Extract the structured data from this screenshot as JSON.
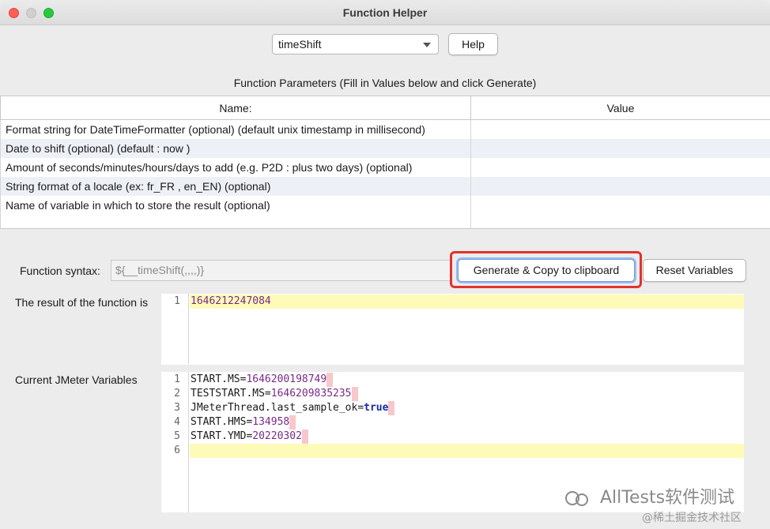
{
  "window": {
    "title": "Function Helper"
  },
  "toolbar": {
    "function_select_value": "timeShift",
    "help_label": "Help"
  },
  "params": {
    "caption": "Function Parameters (Fill in Values below and click Generate)",
    "col_name": "Name:",
    "col_value": "Value",
    "rows": [
      {
        "name": "Format string for DateTimeFormatter (optional) (default unix timestamp in millisecond)",
        "value": ""
      },
      {
        "name": "Date to shift (optional) (default : now )",
        "value": ""
      },
      {
        "name": "Amount of seconds/minutes/hours/days to add (e.g. P2D : plus two days) (optional)",
        "value": ""
      },
      {
        "name": "String format of a locale (ex: fr_FR , en_EN) (optional)",
        "value": ""
      },
      {
        "name": "Name of variable in which to store the result (optional)",
        "value": ""
      }
    ]
  },
  "syntax": {
    "label": "Function syntax:",
    "value": "${__timeShift(,,,,)}"
  },
  "buttons": {
    "generate_label": "Generate & Copy to clipboard",
    "reset_label": "Reset Variables"
  },
  "result": {
    "label": "The result of the function is",
    "lines": [
      {
        "n": "1",
        "text": "1646212247084"
      }
    ]
  },
  "vars": {
    "label": "Current JMeter Variables",
    "lines": [
      {
        "n": "1",
        "key": "START.MS=",
        "val": "1646200198749"
      },
      {
        "n": "2",
        "key": "TESTSTART.MS=",
        "val": "1646209835235"
      },
      {
        "n": "3",
        "key": "JMeterThread.last_sample_ok=",
        "val": "true"
      },
      {
        "n": "4",
        "key": "START.HMS=",
        "val": "134958"
      },
      {
        "n": "5",
        "key": "START.YMD=",
        "val": "20220302"
      },
      {
        "n": "6",
        "key": "",
        "val": ""
      }
    ]
  },
  "watermark": {
    "main": "AllTests软件测试",
    "sub": "@稀土掘金技术社区"
  },
  "colors": {
    "highlight_border": "#e0332d",
    "current_line": "#fefbb8",
    "number_value": "#7a2a8a"
  }
}
